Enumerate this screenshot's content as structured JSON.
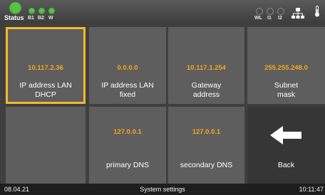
{
  "status_bar": {
    "status_label": "Status",
    "left_indicators": [
      "B1",
      "B2",
      "W"
    ],
    "right_indicators": [
      "WL",
      "I1",
      "I2"
    ],
    "led_on_color": "#59c346",
    "icons": [
      "network-icon",
      "thermometer-icon"
    ]
  },
  "tiles": [
    {
      "value": "10.117.2.36",
      "label_line1": "IP address LAN",
      "label_line2": "DHCP",
      "selected": true
    },
    {
      "value": "0.0.0.0",
      "label_line1": "IP address LAN",
      "label_line2": "fixed"
    },
    {
      "value": "10.117.1.254",
      "label_line1": "Gateway",
      "label_line2": "address"
    },
    {
      "value": "255.255.248.0",
      "label_line1": "Subnet",
      "label_line2": "mask"
    },
    {
      "value": "127.0.0.1",
      "label_line1": "primary DNS"
    },
    {
      "value": "127.0.0.1",
      "label_line1": "secondary DNS"
    }
  ],
  "back": {
    "label": "Back",
    "icon": "arrow-left-icon"
  },
  "bottom_bar": {
    "date": "08.04.21",
    "title": "System settings",
    "time": "10:11:47"
  },
  "colors": {
    "accent_value": "#f5a623",
    "selection_border": "#f4b92b"
  }
}
